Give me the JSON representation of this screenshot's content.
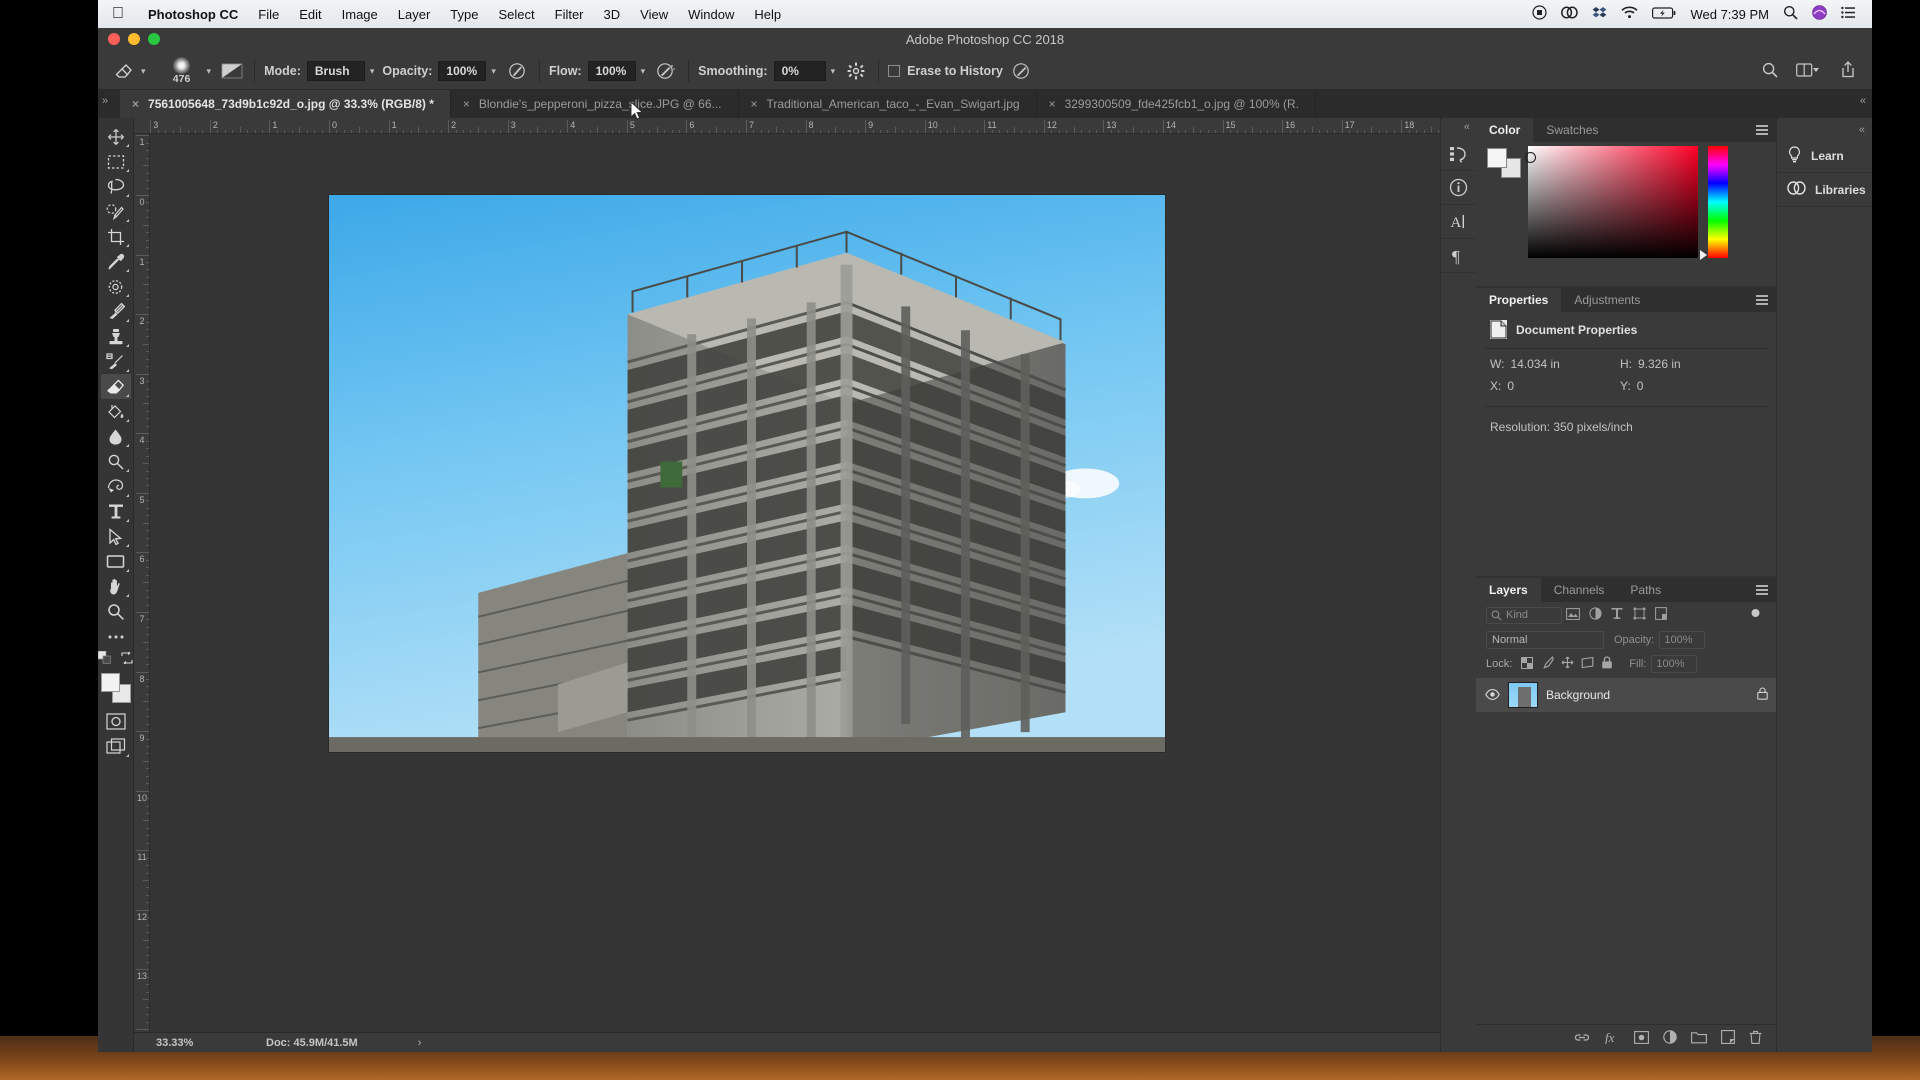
{
  "menubar": {
    "apple": "apple-logo",
    "items": [
      "Photoshop CC",
      "File",
      "Edit",
      "Image",
      "Layer",
      "Type",
      "Select",
      "Filter",
      "3D",
      "View",
      "Window",
      "Help"
    ],
    "clock": "Wed 7:39 PM",
    "status_icons": [
      "screen-record-icon",
      "creative-cloud-icon",
      "dropbox-icon",
      "wifi-icon",
      "battery-icon",
      "spotlight-search-icon",
      "siri-icon",
      "notification-center-icon"
    ]
  },
  "window": {
    "title": "Adobe Photoshop CC 2018"
  },
  "options_bar": {
    "tool_icon": "eraser-tool-icon",
    "brush_size": "476",
    "brush_preset_icon": "brush-preset-icon",
    "mode_label": "Mode:",
    "mode_value": "Brush",
    "opacity_label": "Opacity:",
    "opacity_value": "100%",
    "opacity_pressure_icon": "pressure-opacity-icon",
    "flow_label": "Flow:",
    "flow_value": "100%",
    "airbrush_icon": "airbrush-icon",
    "smoothing_label": "Smoothing:",
    "smoothing_value": "0%",
    "smoothing_options_icon": "gear-icon",
    "erase_to_history_label": "Erase to History",
    "erase_to_history_checked": false,
    "pressure_size_icon": "pressure-size-icon",
    "search_icon": "search-icon",
    "arrange_icon": "arrange-documents-icon",
    "share_icon": "share-icon"
  },
  "tabs": [
    {
      "label": "7561005648_73d9b1c92d_o.jpg @ 33.3% (RGB/8) *",
      "active": true
    },
    {
      "label": "Blondie's_pepperoni_pizza_slice.JPG @ 66...",
      "active": false
    },
    {
      "label": "Traditional_American_taco_-_Evan_Swigart.jpg",
      "active": false
    },
    {
      "label": "3299300509_fde425fcb1_o.jpg @ 100% (R.",
      "active": false
    }
  ],
  "toolbox": [
    {
      "name": "move-tool",
      "icon": "move-tool-icon",
      "selected": false
    },
    {
      "name": "rectangular-marquee-tool",
      "icon": "marquee-tool-icon",
      "selected": false
    },
    {
      "name": "lasso-tool",
      "icon": "lasso-tool-icon",
      "selected": false
    },
    {
      "name": "quick-selection-tool",
      "icon": "quick-selection-tool-icon",
      "selected": false
    },
    {
      "name": "crop-tool",
      "icon": "crop-tool-icon",
      "selected": false
    },
    {
      "name": "eyedropper-tool",
      "icon": "eyedropper-tool-icon",
      "selected": false
    },
    {
      "name": "spot-healing-brush-tool",
      "icon": "healing-brush-tool-icon",
      "selected": false
    },
    {
      "name": "brush-tool",
      "icon": "brush-tool-icon",
      "selected": false
    },
    {
      "name": "clone-stamp-tool",
      "icon": "clone-stamp-tool-icon",
      "selected": false
    },
    {
      "name": "history-brush-tool",
      "icon": "history-brush-tool-icon",
      "selected": false
    },
    {
      "name": "eraser-tool",
      "icon": "eraser-tool-icon",
      "selected": true
    },
    {
      "name": "gradient-tool",
      "icon": "paint-bucket-tool-icon",
      "selected": false
    },
    {
      "name": "blur-tool",
      "icon": "blur-tool-icon",
      "selected": false
    },
    {
      "name": "dodge-tool",
      "icon": "dodge-tool-icon",
      "selected": false
    },
    {
      "name": "pen-tool",
      "icon": "pen-tool-icon",
      "selected": false
    },
    {
      "name": "type-tool",
      "icon": "type-tool-icon",
      "selected": false
    },
    {
      "name": "path-selection-tool",
      "icon": "path-selection-tool-icon",
      "selected": false
    },
    {
      "name": "rectangle-tool",
      "icon": "rectangle-tool-icon",
      "selected": false
    },
    {
      "name": "hand-tool",
      "icon": "hand-tool-icon",
      "selected": false
    },
    {
      "name": "zoom-tool",
      "icon": "zoom-tool-icon",
      "selected": false
    },
    {
      "name": "edit-toolbar",
      "icon": "ellipsis-icon",
      "selected": false
    }
  ],
  "ruler": {
    "unit": "inches",
    "top_ticks": [
      "3",
      "2",
      "1",
      "0",
      "1",
      "2",
      "3",
      "4",
      "5",
      "6",
      "7",
      "8",
      "9",
      "10",
      "11",
      "12",
      "13",
      "14",
      "15",
      "16",
      "1"
    ],
    "left_ticks": [
      "3",
      "2",
      "1",
      "0",
      "1",
      "2",
      "3",
      "4",
      "5",
      "6",
      "7",
      "8",
      "9",
      "10",
      "11"
    ]
  },
  "status_bar": {
    "zoom": "33.33%",
    "doc": "Doc: 45.9M/41.5M",
    "arrow": "›"
  },
  "icon_strip": [
    {
      "name": "history-panel-icon",
      "label": "history-icon"
    },
    {
      "name": "info-panel-icon",
      "label": "info-icon"
    },
    {
      "name": "character-panel-icon",
      "label": "character-icon"
    },
    {
      "name": "paragraph-panel-icon",
      "label": "paragraph-icon"
    }
  ],
  "color_panel": {
    "tabs": [
      {
        "label": "Color",
        "active": true
      },
      {
        "label": "Swatches",
        "active": false
      }
    ],
    "foreground": "#f5f5f5",
    "background": "#e6e6e6",
    "hue_accent": "#ff0026"
  },
  "properties_panel": {
    "tabs": [
      {
        "label": "Properties",
        "active": true
      },
      {
        "label": "Adjustments",
        "active": false
      }
    ],
    "header_icon": "document-icon",
    "header": "Document Properties",
    "w_label": "W:",
    "w_value": "14.034 in",
    "h_label": "H:",
    "h_value": "9.326 in",
    "x_label": "X:",
    "x_value": "0",
    "y_label": "Y:",
    "y_value": "0",
    "resolution": "Resolution: 350 pixels/inch"
  },
  "layers_panel": {
    "tabs": [
      {
        "label": "Layers",
        "active": true
      },
      {
        "label": "Channels",
        "active": false
      },
      {
        "label": "Paths",
        "active": false
      }
    ],
    "filter_kind": "Kind",
    "filter_icons": [
      "filter-pixel-icon",
      "filter-adjustment-icon",
      "filter-type-icon",
      "filter-shape-icon",
      "filter-smart-object-icon"
    ],
    "filter_toggle_icon": "filter-enable-toggle-icon",
    "blend_mode": "Normal",
    "opacity_label": "Opacity:",
    "opacity_value": "100%",
    "lock_label": "Lock:",
    "lock_icons": [
      "lock-transparency-icon",
      "lock-image-icon",
      "lock-position-icon",
      "lock-artboard-icon",
      "lock-all-icon"
    ],
    "fill_label": "Fill:",
    "fill_value": "100%",
    "layers": [
      {
        "name": "Background",
        "visible": true,
        "locked": true,
        "thumbnail": "building-thumbnail"
      }
    ],
    "footer_icons": [
      "link-layers-icon",
      "layer-style-fx-icon",
      "layer-mask-icon",
      "adjustment-layer-icon",
      "new-group-icon",
      "new-layer-icon",
      "delete-layer-icon"
    ]
  },
  "right_dock": {
    "collapse_icon": "collapse-panels-icon",
    "buttons": [
      {
        "label": "Learn",
        "icon": "lightbulb-icon"
      },
      {
        "label": "Libraries",
        "icon": "creative-cloud-libraries-icon"
      }
    ]
  },
  "canvas": {
    "image_alt": "concrete-building-under-construction-against-blue-sky",
    "sky_color": "#7ec8f2",
    "concrete_color": "#9a9a96"
  }
}
